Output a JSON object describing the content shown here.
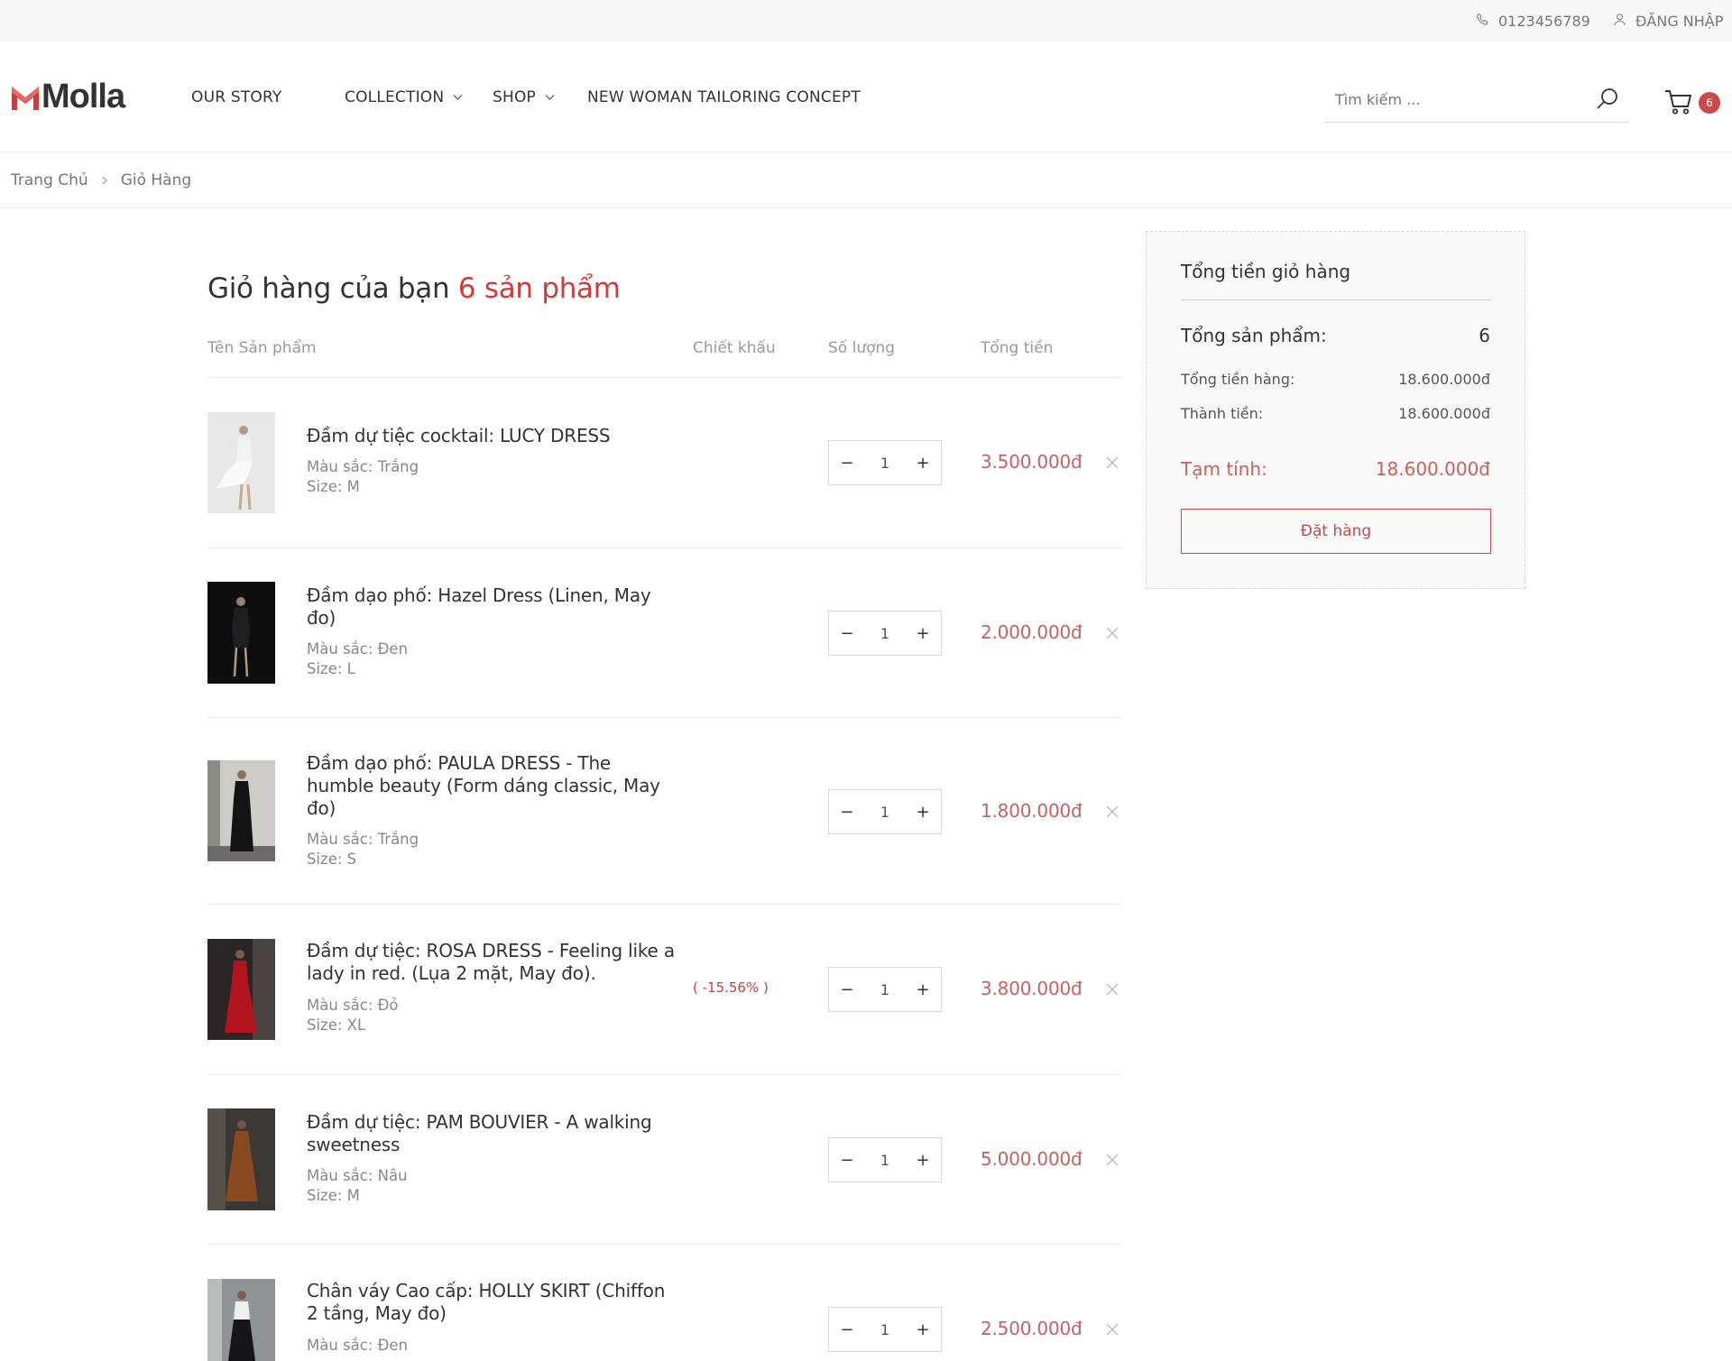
{
  "topbar": {
    "phone": "0123456789",
    "login": "ĐĂNG NHẬP"
  },
  "logo": {
    "text": "Molla",
    "brand_color": "#d23939"
  },
  "nav": [
    {
      "label": "OUR STORY"
    },
    {
      "label": "COLLECTION"
    },
    {
      "label": "SHOP"
    },
    {
      "label": "NEW WOMAN TAILORING CONCEPT"
    }
  ],
  "search": {
    "placeholder": "Tìm kiếm ..."
  },
  "cart": {
    "count": "6"
  },
  "breadcrumb": {
    "home": "Trang Chủ",
    "current": "Giỏ Hàng"
  },
  "cart_page": {
    "title": "Giỏ hàng của bạn",
    "count_label": "6 sản phẩm",
    "columns": {
      "product": "Tên Sản phẩm",
      "discount": "Chiết khấu",
      "quantity": "Số lượng",
      "total": "Tổng tiền"
    },
    "items": [
      {
        "name": "Đầm dự tiệc cocktail: LUCY DRESS",
        "color": "Màu sắc: Trắng",
        "size": "Size: M",
        "discount": "",
        "qty": "1",
        "total": "3.500.000đ"
      },
      {
        "name": "Đầm dạo phố: Hazel Dress (Linen, May đo)",
        "color": "Màu sắc: Đen",
        "size": "Size: L",
        "discount": "",
        "qty": "1",
        "total": "2.000.000đ"
      },
      {
        "name": "Đầm dạo phố: PAULA DRESS - The humble beauty (Form dáng classic, May đo)",
        "color": "Màu sắc: Trắng",
        "size": "Size: S",
        "discount": "",
        "qty": "1",
        "total": "1.800.000đ"
      },
      {
        "name": "Đầm dự tiệc: ROSA DRESS - Feeling like a lady in red. (Lụa 2 mặt, May đo).",
        "color": "Màu sắc: Đỏ",
        "size": "Size: XL",
        "discount": "( -15.56% )",
        "qty": "1",
        "total": "3.800.000đ"
      },
      {
        "name": "Đầm dự tiệc: PAM BOUVIER - A walking sweetness",
        "color": "Màu sắc: Nâu",
        "size": "Size: M",
        "discount": "",
        "qty": "1",
        "total": "5.000.000đ"
      },
      {
        "name": "Chân váy Cao cấp: HOLLY SKIRT (Chiffon 2 tầng, May đo)",
        "color": "Màu sắc: Đen",
        "size": "",
        "discount": "",
        "qty": "1",
        "total": "2.500.000đ"
      }
    ]
  },
  "summary": {
    "title": "Tổng tiền giỏ hàng",
    "total_items_label": "Tổng sản phẩm:",
    "total_items_value": "6",
    "subtotal_label": "Tổng tiền hàng:",
    "subtotal_value": "18.600.000đ",
    "total_label": "Thành tiền:",
    "total_value": "18.600.000đ",
    "estimate_label": "Tạm tính:",
    "estimate_value": "18.600.000đ",
    "order_button": "Đặt hàng"
  }
}
